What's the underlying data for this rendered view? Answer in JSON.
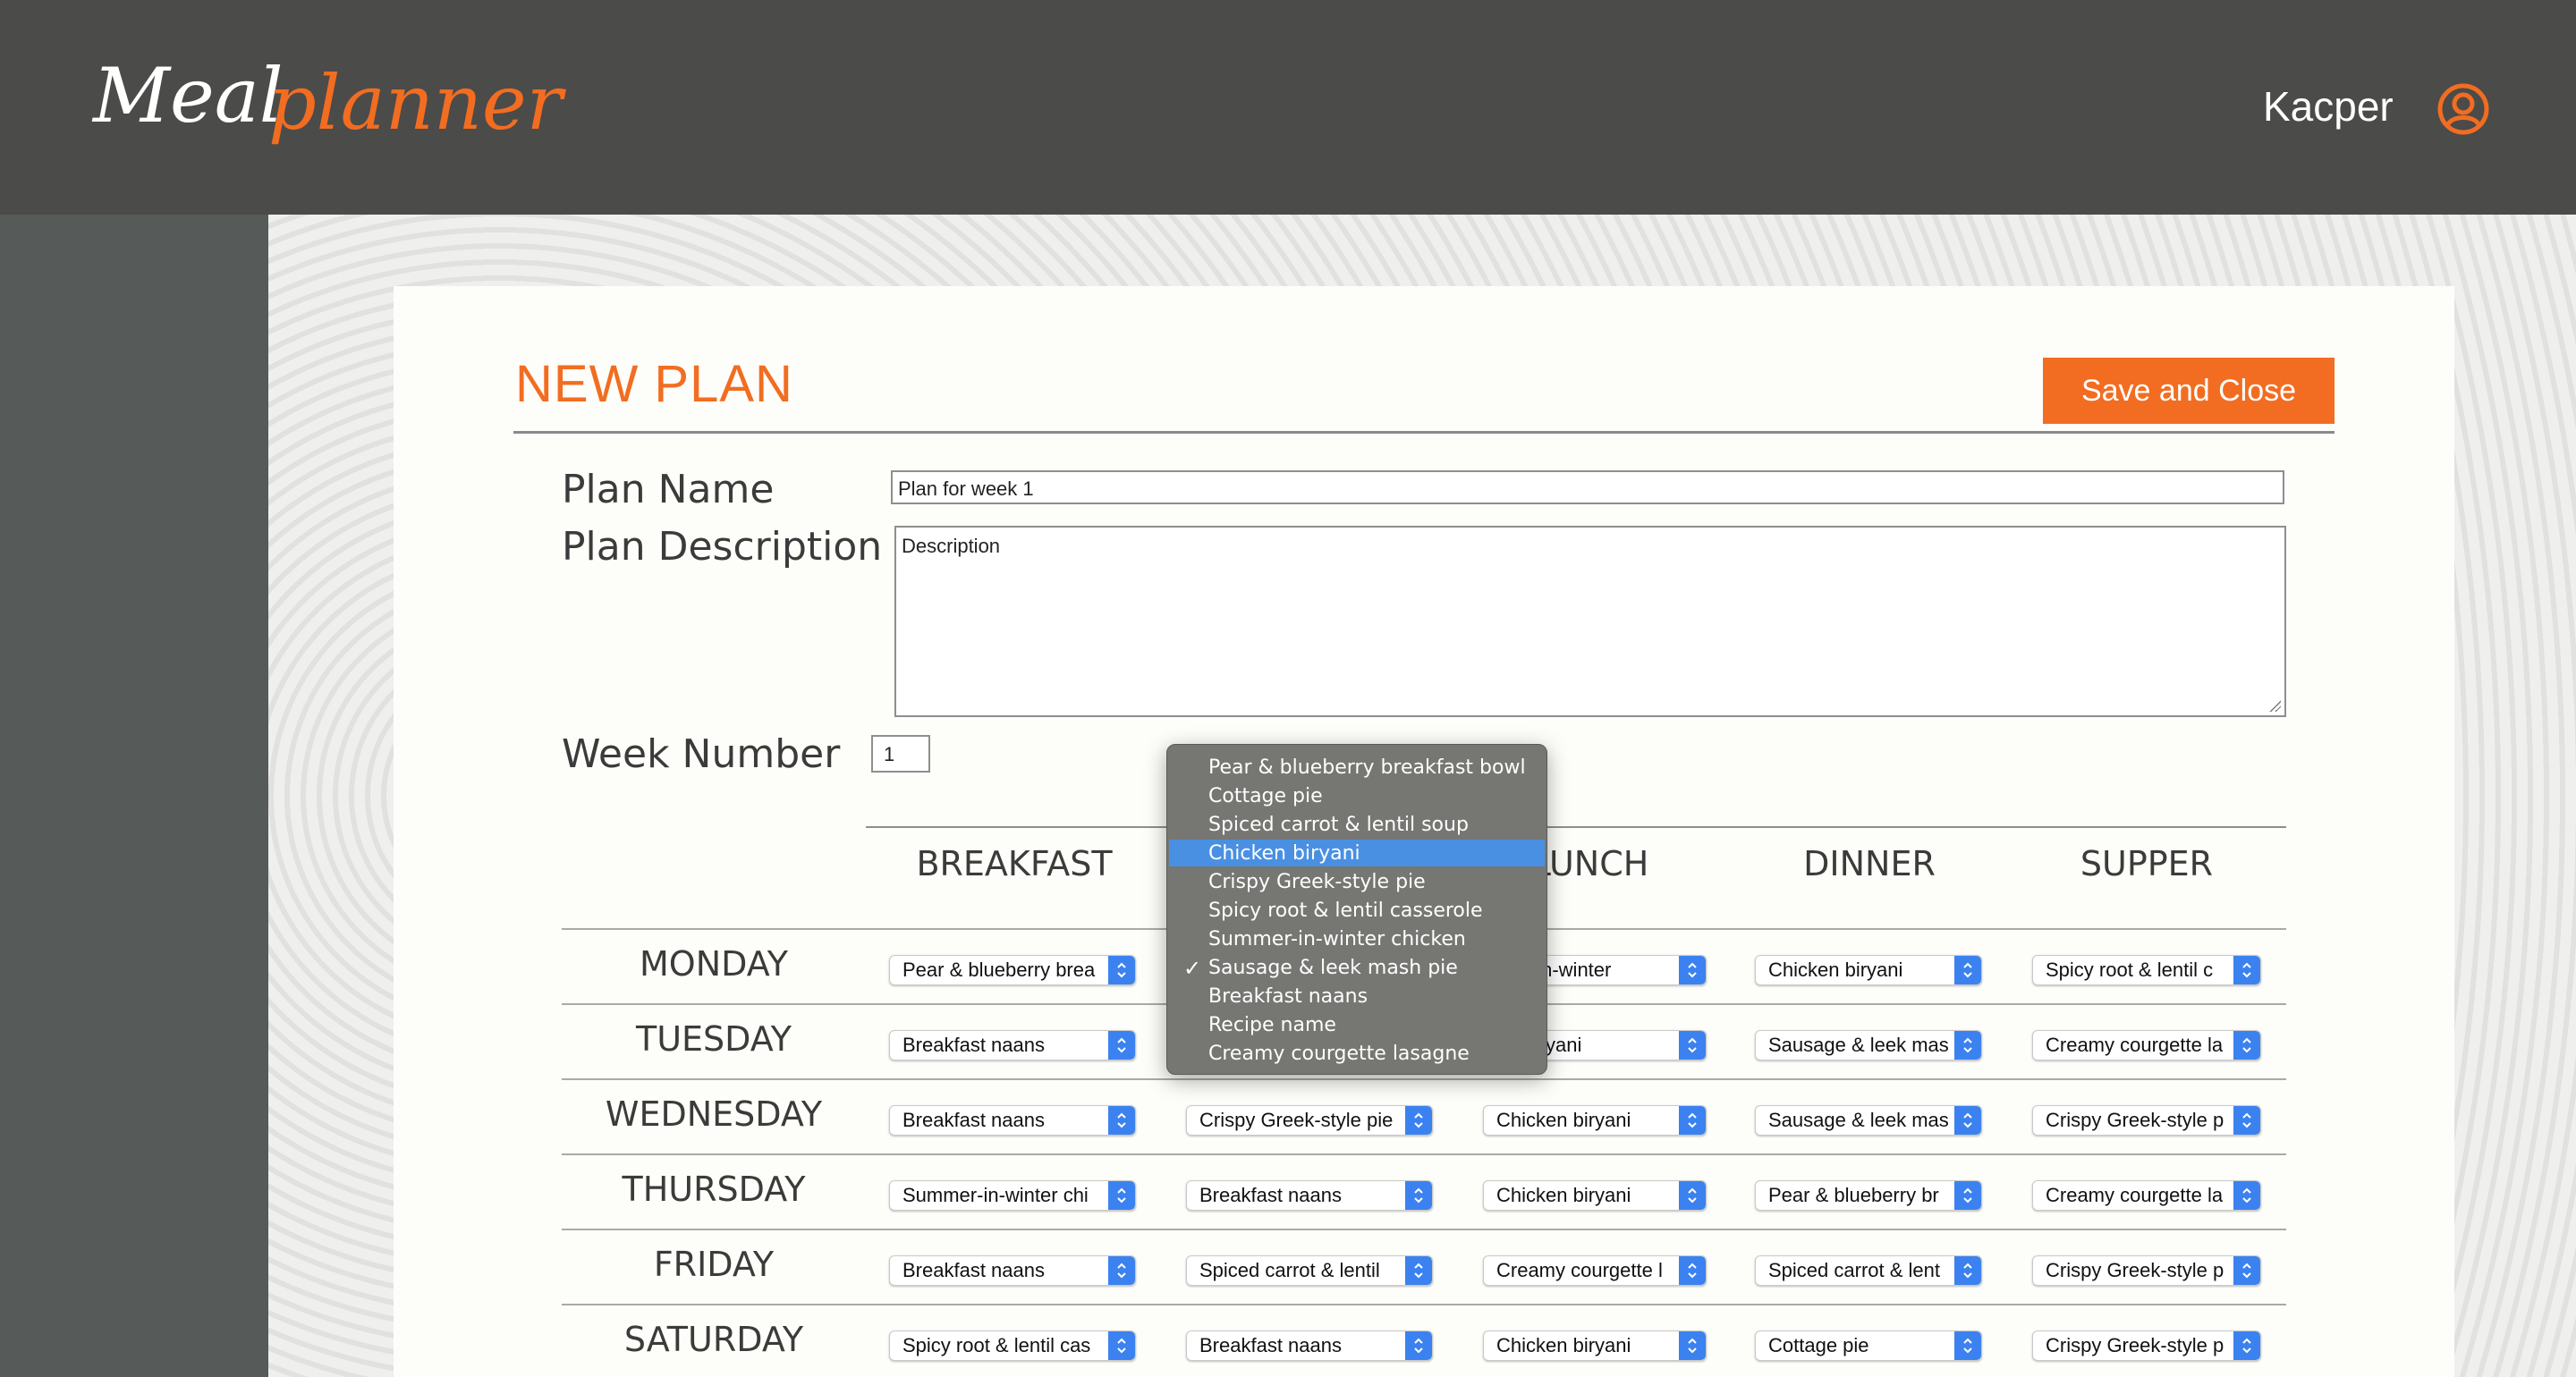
{
  "header": {
    "logo_word1": "Meal",
    "logo_word2": "planner",
    "username": "Kacper",
    "user_icon": "user-circle-icon"
  },
  "form": {
    "title": "NEW PLAN",
    "save_label": "Save and Close",
    "plan_name_label": "Plan Name",
    "plan_name_value": "Plan for week 1",
    "plan_desc_label": "Plan Description",
    "plan_desc_placeholder": "Description",
    "week_label": "Week Number",
    "week_value": "1"
  },
  "grid": {
    "columns": [
      "BREAKFAST",
      "",
      "LUNCH",
      "DINNER",
      "SUPPER"
    ],
    "days": [
      "MONDAY",
      "TUESDAY",
      "WEDNESDAY",
      "THURSDAY",
      "FRIDAY",
      "SATURDAY"
    ],
    "cells": [
      [
        "Pear & blueberry brea",
        "",
        "mer-in-winter",
        "Chicken biryani",
        "Spicy root & lentil c"
      ],
      [
        "Breakfast naans",
        "",
        "en biryani",
        "Sausage & leek mas",
        "Creamy courgette la"
      ],
      [
        "Breakfast naans",
        "Crispy Greek-style pie",
        "Chicken biryani",
        "Sausage & leek mas",
        "Crispy Greek-style p"
      ],
      [
        "Summer-in-winter chi",
        "Breakfast naans",
        "Chicken biryani",
        "Pear & blueberry br",
        "Creamy courgette la"
      ],
      [
        "Breakfast naans",
        "Spiced carrot & lentil",
        "Creamy courgette l",
        "Spiced carrot & lent",
        "Crispy Greek-style p"
      ],
      [
        "Spicy root & lentil cas",
        "Breakfast naans",
        "Chicken biryani",
        "Cottage pie",
        "Crispy Greek-style p"
      ]
    ]
  },
  "dropdown": {
    "options": [
      "Pear & blueberry breakfast bowl",
      "Cottage pie",
      "Spiced carrot & lentil soup",
      "Chicken biryani",
      "Crispy Greek-style pie",
      "Spicy root & lentil casserole",
      "Summer-in-winter chicken",
      "Sausage & leek mash pie",
      "Breakfast naans",
      "Recipe name",
      "Creamy courgette lasagne"
    ],
    "highlighted": "Chicken biryani",
    "checked": "Sausage & leek mash pie",
    "highlight_color": "#4a90e2"
  },
  "colors": {
    "accent": "#f26d21",
    "header_bg": "#4b4b49",
    "select_arrow": "#3b82f0"
  }
}
